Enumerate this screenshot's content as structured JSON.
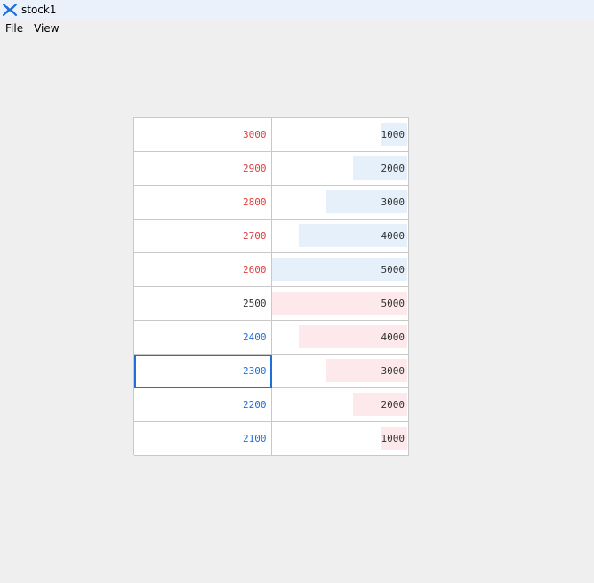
{
  "window": {
    "title": "stock1"
  },
  "menu": {
    "items": [
      "File",
      "View"
    ]
  },
  "colors": {
    "ask_price": "#e23b3b",
    "mid_price": "#333333",
    "bid_price": "#1e6fd9",
    "ask_bar": "#e6f0fb",
    "bid_bar": "#fde9eb",
    "selection": "#1e6fd9"
  },
  "order_book": {
    "max_volume": 5000,
    "selected_price": "2300",
    "rows": [
      {
        "price": "3000",
        "volume": "1000",
        "side": "ask"
      },
      {
        "price": "2900",
        "volume": "2000",
        "side": "ask"
      },
      {
        "price": "2800",
        "volume": "3000",
        "side": "ask"
      },
      {
        "price": "2700",
        "volume": "4000",
        "side": "ask"
      },
      {
        "price": "2600",
        "volume": "5000",
        "side": "ask"
      },
      {
        "price": "2500",
        "volume": "5000",
        "side": "mid"
      },
      {
        "price": "2400",
        "volume": "4000",
        "side": "bid"
      },
      {
        "price": "2300",
        "volume": "3000",
        "side": "bid"
      },
      {
        "price": "2200",
        "volume": "2000",
        "side": "bid"
      },
      {
        "price": "2100",
        "volume": "1000",
        "side": "bid"
      }
    ]
  }
}
